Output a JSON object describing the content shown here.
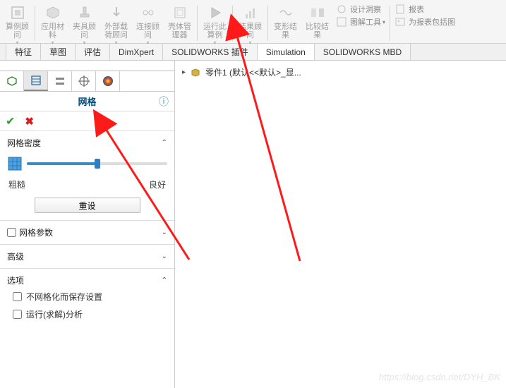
{
  "ribbon": {
    "buttons": [
      {
        "label": "算例顾\n问"
      },
      {
        "label": "应用材\n料"
      },
      {
        "label": "夹具顾\n问"
      },
      {
        "label": "外部载\n荷顾问"
      },
      {
        "label": "连接顾\n问"
      },
      {
        "label": "壳体管\n理器"
      },
      {
        "label": "运行此\n算例"
      },
      {
        "label": "结果顾\n问"
      },
      {
        "label": "变形结\n果"
      },
      {
        "label": "比较结\n果"
      }
    ],
    "side_items": [
      {
        "label": "设计洞察"
      },
      {
        "label": "图解工具"
      },
      {
        "label": "报表"
      },
      {
        "label": "为报表包括图"
      }
    ]
  },
  "tabs": [
    "特征",
    "草图",
    "评估",
    "DimXpert",
    "SOLIDWORKS 插件",
    "Simulation",
    "SOLIDWORKS MBD"
  ],
  "panel": {
    "title": "网格",
    "density": {
      "label": "网格密度",
      "coarse": "粗糙",
      "fine": "良好",
      "reset": "重设"
    },
    "mesh_params": "网格参数",
    "advanced": "高级",
    "options": "选项",
    "opt1": "不网格化而保存设置",
    "opt2": "运行(求解)分析"
  },
  "tree": {
    "item": "零件1  (默认<<默认>_显..."
  },
  "watermark": "https://blog.csdn.net/DYH_BK"
}
